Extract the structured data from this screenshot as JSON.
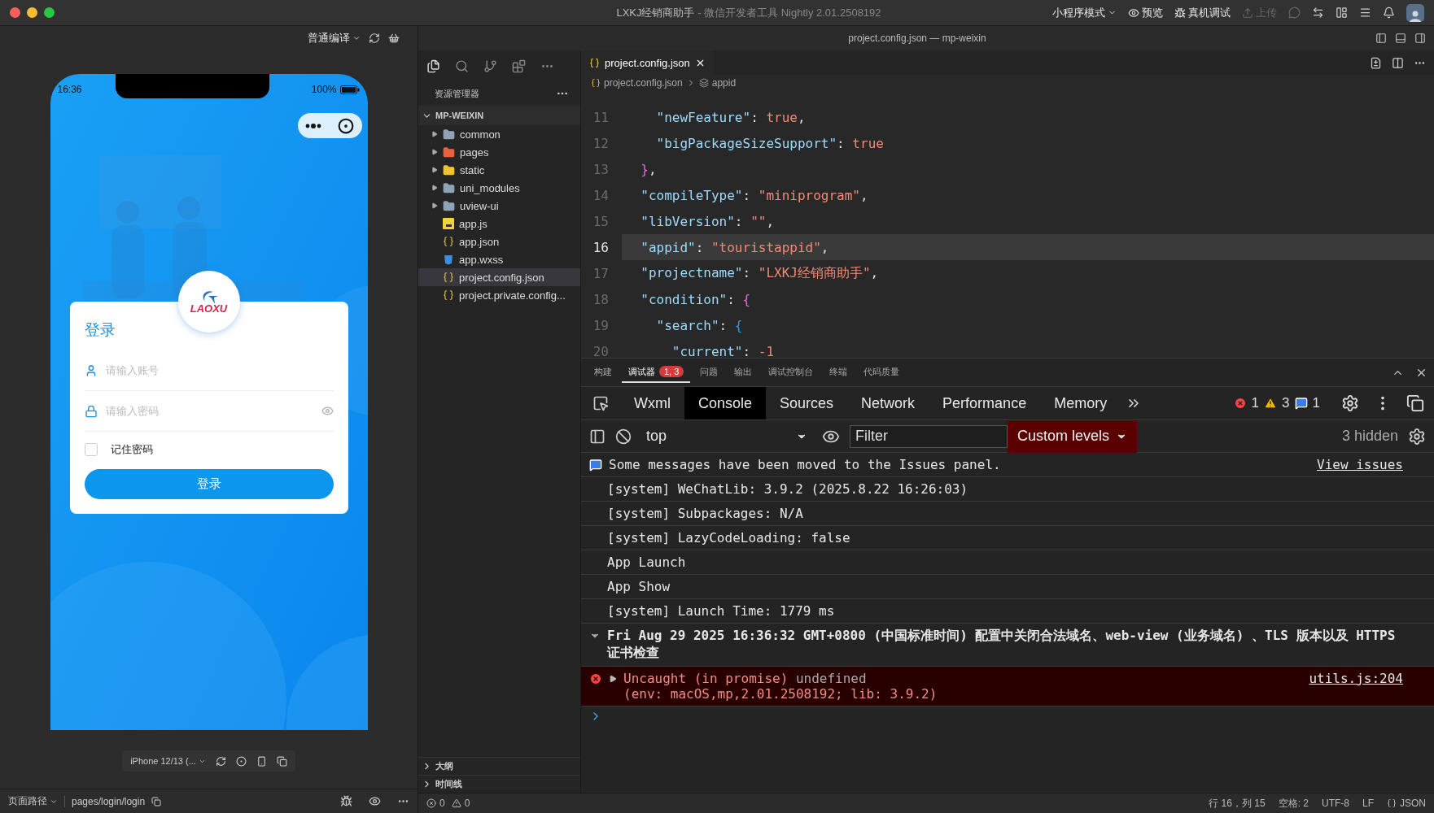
{
  "window": {
    "title": "LXKJ经销商助手",
    "subtitle": "- 微信开发者工具 Nightly 2.01.2508192"
  },
  "toolbar": [
    {
      "label": "小程序模式",
      "kind": "dropdown",
      "disabled": false
    },
    {
      "label": "预览",
      "kind": "preview",
      "disabled": false
    },
    {
      "label": "真机调试",
      "kind": "debug",
      "disabled": false
    },
    {
      "label": "上传",
      "kind": "upload",
      "disabled": true
    }
  ],
  "simulator": {
    "compile_mode": "普通编译",
    "device": "iPhone 12/13 (...",
    "page_path_label": "页面路径",
    "page_path": "pages/login/login",
    "phone": {
      "time": "16:36",
      "battery": "100%",
      "logo_text": "LAOXU",
      "title": "登录",
      "account_placeholder": "请输入账号",
      "password_placeholder": "请输入密码",
      "remember": {
        "label": "记住密码",
        "checked": false
      },
      "login_button": "登录"
    }
  },
  "editor_window_title": "project.config.json — mp-weixin",
  "explorer": {
    "title": "资源管理器",
    "root": {
      "label": "MP-WEIXIN",
      "expanded": true
    },
    "items": [
      {
        "name": "common",
        "kind": "folder",
        "expanded": false,
        "selected": false
      },
      {
        "name": "pages",
        "kind": "pages-folder",
        "expanded": false,
        "selected": false
      },
      {
        "name": "static",
        "kind": "static-folder",
        "expanded": false,
        "selected": false
      },
      {
        "name": "uni_modules",
        "kind": "folder",
        "expanded": false,
        "selected": false
      },
      {
        "name": "uview-ui",
        "kind": "folder",
        "expanded": false,
        "selected": false
      },
      {
        "name": "app.js",
        "kind": "js",
        "selected": false
      },
      {
        "name": "app.json",
        "kind": "json",
        "selected": false
      },
      {
        "name": "app.wxss",
        "kind": "wxss",
        "selected": false
      },
      {
        "name": "project.config.json",
        "kind": "json",
        "selected": true
      },
      {
        "name": "project.private.config...",
        "kind": "json",
        "selected": false
      }
    ],
    "sections": [
      {
        "label": "大纲",
        "expanded": false
      },
      {
        "label": "时间线",
        "expanded": false
      }
    ]
  },
  "editor": {
    "tabs": [
      {
        "label": "project.config.json",
        "selected": true
      }
    ],
    "breadcrumb": [
      "project.config.json",
      "appid"
    ],
    "lines": [
      {
        "number": "11",
        "selected": false,
        "tokens": [
          {
            "kind": "key",
            "text": "    \"newFeature\""
          },
          {
            "kind": "punct",
            "text": ": "
          },
          {
            "kind": "lit",
            "text": "true"
          },
          {
            "kind": "punct",
            "text": ","
          }
        ]
      },
      {
        "number": "12",
        "selected": false,
        "tokens": [
          {
            "kind": "key",
            "text": "    \"bigPackageSizeSupport\""
          },
          {
            "kind": "punct",
            "text": ": "
          },
          {
            "kind": "lit",
            "text": "true"
          }
        ]
      },
      {
        "number": "13",
        "selected": false,
        "tokens": [
          {
            "kind": "brace1",
            "text": "  }"
          },
          {
            "kind": "punct",
            "text": ","
          }
        ]
      },
      {
        "number": "14",
        "selected": false,
        "tokens": [
          {
            "kind": "key",
            "text": "  \"compileType\""
          },
          {
            "kind": "punct",
            "text": ": "
          },
          {
            "kind": "str",
            "text": "\"miniprogram\""
          },
          {
            "kind": "punct",
            "text": ","
          }
        ]
      },
      {
        "number": "15",
        "selected": false,
        "tokens": [
          {
            "kind": "key",
            "text": "  \"libVersion\""
          },
          {
            "kind": "punct",
            "text": ": "
          },
          {
            "kind": "str",
            "text": "\"\""
          },
          {
            "kind": "punct",
            "text": ","
          }
        ]
      },
      {
        "number": "16",
        "selected": true,
        "tokens": [
          {
            "kind": "key",
            "text": "  \"appid\""
          },
          {
            "kind": "punct",
            "text": ": "
          },
          {
            "kind": "str",
            "text": "\"touristappid\""
          },
          {
            "kind": "punct",
            "text": ","
          }
        ]
      },
      {
        "number": "17",
        "selected": false,
        "tokens": [
          {
            "kind": "key",
            "text": "  \"projectname\""
          },
          {
            "kind": "punct",
            "text": ": "
          },
          {
            "kind": "str",
            "text": "\"LXKJ经销商助手\""
          },
          {
            "kind": "punct",
            "text": ","
          }
        ]
      },
      {
        "number": "18",
        "selected": false,
        "tokens": [
          {
            "kind": "key",
            "text": "  \"condition\""
          },
          {
            "kind": "punct",
            "text": ": "
          },
          {
            "kind": "brace1",
            "text": "{"
          }
        ]
      },
      {
        "number": "19",
        "selected": false,
        "tokens": [
          {
            "kind": "key",
            "text": "    \"search\""
          },
          {
            "kind": "punct",
            "text": ": "
          },
          {
            "kind": "brace2",
            "text": "{"
          }
        ]
      },
      {
        "number": "20",
        "selected": false,
        "tokens": [
          {
            "kind": "key",
            "text": "      \"current\""
          },
          {
            "kind": "punct",
            "text": ": "
          },
          {
            "kind": "lit",
            "text": "-1"
          }
        ]
      }
    ]
  },
  "panel": {
    "tabs": [
      {
        "label": "构建",
        "selected": false
      },
      {
        "label": "调试器",
        "selected": true,
        "badge": "1, 3"
      },
      {
        "label": "问题",
        "selected": false
      },
      {
        "label": "输出",
        "selected": false
      },
      {
        "label": "调试控制台",
        "selected": false
      },
      {
        "label": "终端",
        "selected": false
      },
      {
        "label": "代码质量",
        "selected": false
      }
    ]
  },
  "devtools": {
    "tabs": [
      {
        "label": "Wxml",
        "selected": false
      },
      {
        "label": "Console",
        "selected": true
      },
      {
        "label": "Sources",
        "selected": false
      },
      {
        "label": "Network",
        "selected": false
      },
      {
        "label": "Performance",
        "selected": false
      },
      {
        "label": "Memory",
        "selected": false
      }
    ],
    "counts": {
      "errors": "1",
      "warnings": "3",
      "info": "1"
    }
  },
  "console": {
    "context": "top",
    "filter_placeholder": "Filter",
    "levels": "Custom levels",
    "hidden": "3 hidden",
    "messages": [
      {
        "kind": "info",
        "text": "Some messages have been moved to the Issues panel.",
        "link": "View issues"
      },
      {
        "kind": "log",
        "text": "[system] WeChatLib: 3.9.2 (2025.8.22 16:26:03)"
      },
      {
        "kind": "log",
        "text": "[system] Subpackages: N/A"
      },
      {
        "kind": "log",
        "text": "[system] LazyCodeLoading: false"
      },
      {
        "kind": "log",
        "text": "App Launch"
      },
      {
        "kind": "log",
        "text": "App Show"
      },
      {
        "kind": "log",
        "text": "[system] Launch Time: 1779 ms"
      },
      {
        "kind": "group",
        "expanded": true,
        "text": "Fri Aug 29 2025 16:36:32 GMT+0800 (中国标准时间) 配置中关闭合法域名、web-view (业务域名) 、TLS 版本以及 HTTPS 证书检查"
      },
      {
        "kind": "error",
        "expanded": false,
        "text": "Uncaught (in promise)",
        "detail": "undefined",
        "env": "(env: macOS,mp,2.01.2508192; lib: 3.9.2)",
        "link": "utils.js:204"
      }
    ]
  },
  "status_bar": {
    "errors": "0",
    "warnings": "0",
    "items": [
      "行 16，列 15",
      "空格: 2",
      "UTF-8",
      "LF"
    ],
    "language": "JSON"
  }
}
